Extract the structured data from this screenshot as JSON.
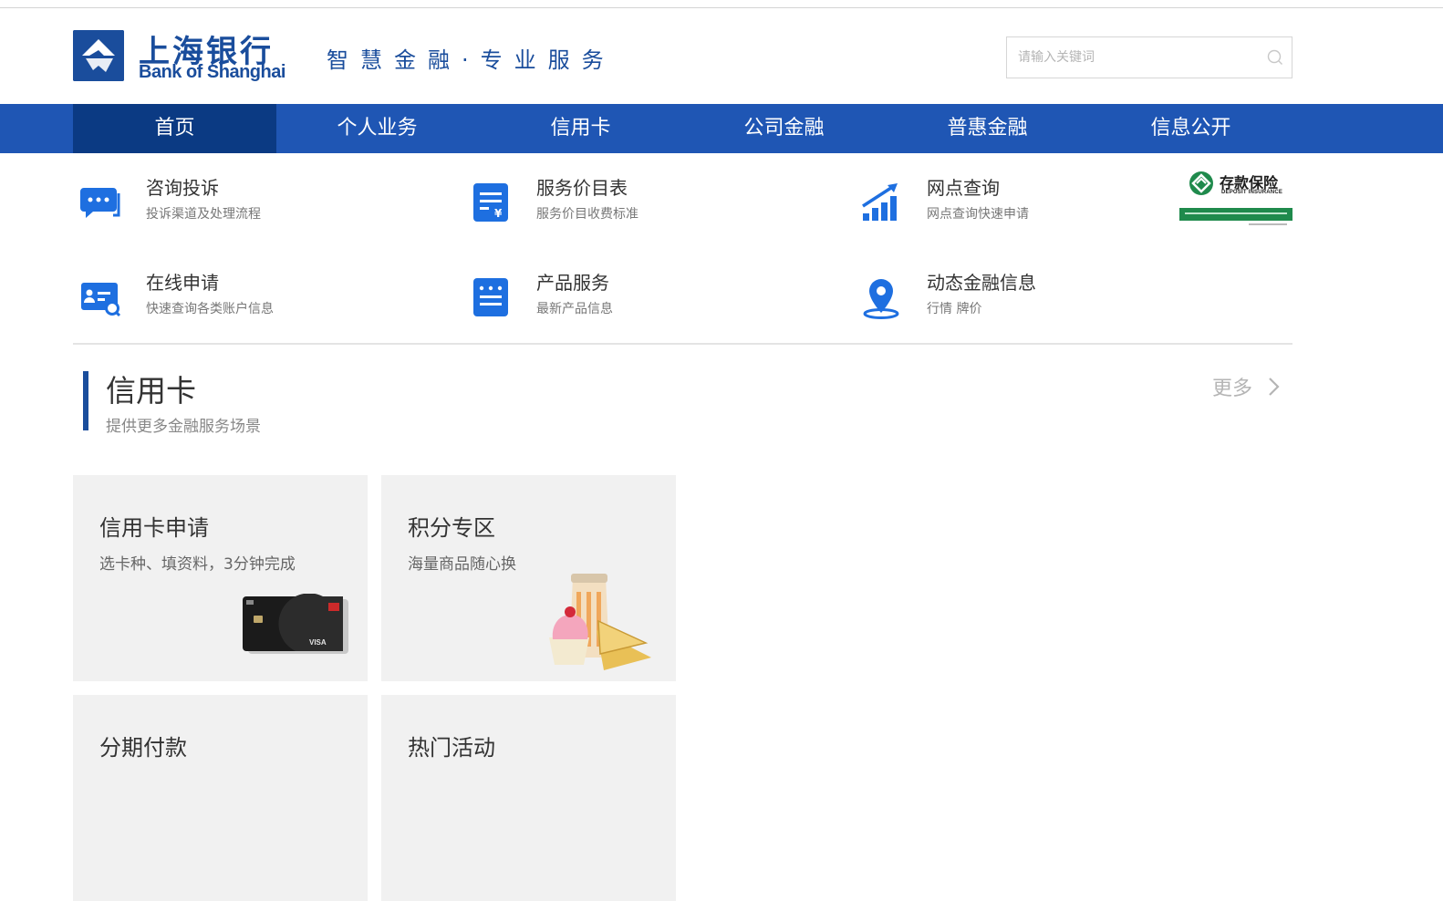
{
  "header": {
    "logo_cn": "上海银行",
    "logo_en": "Bank of Shanghai",
    "slogan": "智慧金融·专业服务",
    "search_placeholder": "请输入关键词"
  },
  "nav": {
    "items": [
      {
        "label": "首页",
        "active": true
      },
      {
        "label": "个人业务"
      },
      {
        "label": "信用卡"
      },
      {
        "label": "公司金融"
      },
      {
        "label": "普惠金融"
      },
      {
        "label": "信息公开"
      }
    ]
  },
  "quick_links": [
    {
      "title": "咨询投诉",
      "desc": "投诉渠道及处理流程",
      "icon": "chat-bubble-icon"
    },
    {
      "title": "服务价目表",
      "desc": "服务价目收费标准",
      "icon": "price-list-icon"
    },
    {
      "title": "网点查询",
      "desc": "网点查询快速申请",
      "icon": "bar-chart-icon"
    },
    {
      "title": "在线申请",
      "desc": "快速查询各类账户信息",
      "icon": "id-card-search-icon"
    },
    {
      "title": "产品服务",
      "desc": "最新产品信息",
      "icon": "product-list-icon"
    },
    {
      "title": "动态金融信息",
      "desc": "行情 牌价",
      "icon": "location-pin-icon"
    }
  ],
  "deposit_insurance": {
    "cn": "存款保险",
    "en": "DEPOSIT INSURANCE"
  },
  "section": {
    "title": "信用卡",
    "subtitle": "提供更多金融服务场景",
    "more": "更多"
  },
  "cards": [
    {
      "title": "信用卡申请",
      "desc": "选卡种、填资料，3分钟完成"
    },
    {
      "title": "积分专区",
      "desc": "海量商品随心换"
    },
    {
      "title": "分期付款",
      "desc": ""
    },
    {
      "title": "热门活动",
      "desc": ""
    }
  ],
  "colors": {
    "brand": "#1a4d9c",
    "nav": "#1f56b4",
    "nav_active": "#0b3a83",
    "icon_blue": "#1e6fe0"
  }
}
